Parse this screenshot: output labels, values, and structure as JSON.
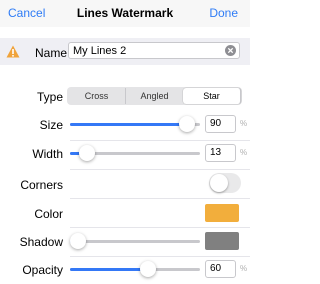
{
  "nav": {
    "cancel": "Cancel",
    "title": "Lines Watermark",
    "done": "Done"
  },
  "name": {
    "label": "Name",
    "value": "My Lines 2"
  },
  "type": {
    "label": "Type",
    "options": [
      "Cross",
      "Angled",
      "Star"
    ],
    "selected": "Star"
  },
  "size": {
    "label": "Size",
    "value": "90",
    "unit": "%",
    "level": 0.9
  },
  "width": {
    "label": "Width",
    "value": "13",
    "unit": "%",
    "level": 0.13
  },
  "corners": {
    "label": "Corners",
    "on": false
  },
  "color": {
    "label": "Color",
    "swatch": "#f2ae3c"
  },
  "shadow": {
    "label": "Shadow",
    "swatch": "#808080",
    "level": 0.0
  },
  "opacity": {
    "label": "Opacity",
    "value": "60",
    "unit": "%",
    "level": 0.6
  },
  "colors": {
    "accent": "#3478f6",
    "warning": "#f0a33a"
  }
}
